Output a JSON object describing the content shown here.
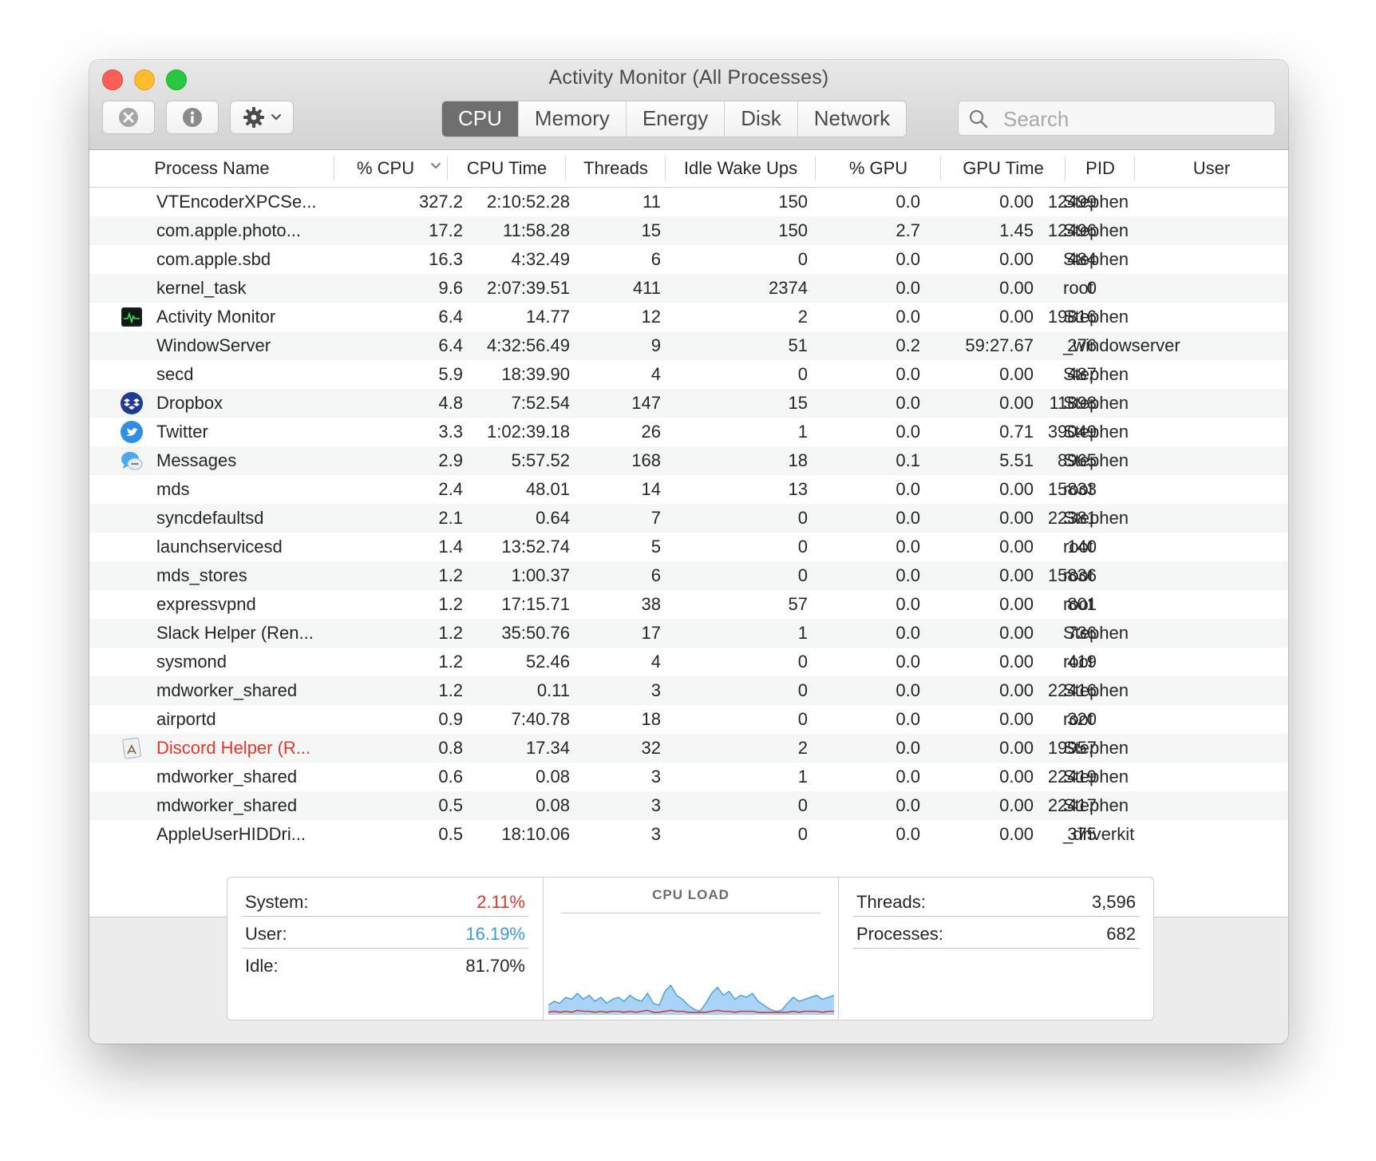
{
  "window": {
    "title": "Activity Monitor (All Processes)"
  },
  "toolbar": {
    "stop_icon": "xmark-circle-icon",
    "info_icon": "info-icon",
    "gear_icon": "gear-icon",
    "tabs": [
      {
        "label": "CPU",
        "active": true
      },
      {
        "label": "Memory",
        "active": false
      },
      {
        "label": "Energy",
        "active": false
      },
      {
        "label": "Disk",
        "active": false
      },
      {
        "label": "Network",
        "active": false
      }
    ],
    "search_placeholder": "Search"
  },
  "table": {
    "columns": [
      "Process Name",
      "% CPU",
      "CPU Time",
      "Threads",
      "Idle Wake Ups",
      "% GPU",
      "GPU Time",
      "PID",
      "User"
    ],
    "sort_column": "% CPU",
    "sort_direction": "descending",
    "rows": [
      {
        "icon": "",
        "name": "VTEncoderXPCSe...",
        "cpu": "327.2",
        "cpu_time": "2:10:52.28",
        "threads": "11",
        "idle": "150",
        "gpu": "0.0",
        "gpu_time": "0.00",
        "pid": "12499",
        "user": "Stephen"
      },
      {
        "icon": "",
        "name": "com.apple.photo...",
        "cpu": "17.2",
        "cpu_time": "11:58.28",
        "threads": "15",
        "idle": "150",
        "gpu": "2.7",
        "gpu_time": "1.45",
        "pid": "12496",
        "user": "Stephen"
      },
      {
        "icon": "",
        "name": "com.apple.sbd",
        "cpu": "16.3",
        "cpu_time": "4:32.49",
        "threads": "6",
        "idle": "0",
        "gpu": "0.0",
        "gpu_time": "0.00",
        "pid": "484",
        "user": "Stephen"
      },
      {
        "icon": "",
        "name": "kernel_task",
        "cpu": "9.6",
        "cpu_time": "2:07:39.51",
        "threads": "411",
        "idle": "2374",
        "gpu": "0.0",
        "gpu_time": "0.00",
        "pid": "0",
        "user": "root"
      },
      {
        "icon": "activity-monitor-icon",
        "name": "Activity Monitor",
        "cpu": "6.4",
        "cpu_time": "14.77",
        "threads": "12",
        "idle": "2",
        "gpu": "0.0",
        "gpu_time": "0.00",
        "pid": "19816",
        "user": "Stephen"
      },
      {
        "icon": "",
        "name": "WindowServer",
        "cpu": "6.4",
        "cpu_time": "4:32:56.49",
        "threads": "9",
        "idle": "51",
        "gpu": "0.2",
        "gpu_time": "59:27.67",
        "pid": "276",
        "user": "_windowserver"
      },
      {
        "icon": "",
        "name": "secd",
        "cpu": "5.9",
        "cpu_time": "18:39.90",
        "threads": "4",
        "idle": "0",
        "gpu": "0.0",
        "gpu_time": "0.00",
        "pid": "487",
        "user": "Stephen"
      },
      {
        "icon": "dropbox-icon",
        "name": "Dropbox",
        "cpu": "4.8",
        "cpu_time": "7:52.54",
        "threads": "147",
        "idle": "15",
        "gpu": "0.0",
        "gpu_time": "0.00",
        "pid": "11898",
        "user": "Stephen"
      },
      {
        "icon": "twitter-icon",
        "name": "Twitter",
        "cpu": "3.3",
        "cpu_time": "1:02:39.18",
        "threads": "26",
        "idle": "1",
        "gpu": "0.0",
        "gpu_time": "0.71",
        "pid": "39049",
        "user": "Stephen"
      },
      {
        "icon": "messages-icon",
        "name": "Messages",
        "cpu": "2.9",
        "cpu_time": "5:57.52",
        "threads": "168",
        "idle": "18",
        "gpu": "0.1",
        "gpu_time": "5.51",
        "pid": "8965",
        "user": "Stephen"
      },
      {
        "icon": "",
        "name": "mds",
        "cpu": "2.4",
        "cpu_time": "48.01",
        "threads": "14",
        "idle": "13",
        "gpu": "0.0",
        "gpu_time": "0.00",
        "pid": "15833",
        "user": "root"
      },
      {
        "icon": "",
        "name": "syncdefaultsd",
        "cpu": "2.1",
        "cpu_time": "0.64",
        "threads": "7",
        "idle": "0",
        "gpu": "0.0",
        "gpu_time": "0.00",
        "pid": "22381",
        "user": "Stephen"
      },
      {
        "icon": "",
        "name": "launchservicesd",
        "cpu": "1.4",
        "cpu_time": "13:52.74",
        "threads": "5",
        "idle": "0",
        "gpu": "0.0",
        "gpu_time": "0.00",
        "pid": "140",
        "user": "root"
      },
      {
        "icon": "",
        "name": "mds_stores",
        "cpu": "1.2",
        "cpu_time": "1:00.37",
        "threads": "6",
        "idle": "0",
        "gpu": "0.0",
        "gpu_time": "0.00",
        "pid": "15836",
        "user": "root"
      },
      {
        "icon": "",
        "name": "expressvpnd",
        "cpu": "1.2",
        "cpu_time": "17:15.71",
        "threads": "38",
        "idle": "57",
        "gpu": "0.0",
        "gpu_time": "0.00",
        "pid": "801",
        "user": "root"
      },
      {
        "icon": "",
        "name": "Slack Helper (Ren...",
        "cpu": "1.2",
        "cpu_time": "35:50.76",
        "threads": "17",
        "idle": "1",
        "gpu": "0.0",
        "gpu_time": "0.00",
        "pid": "736",
        "user": "Stephen"
      },
      {
        "icon": "",
        "name": "sysmond",
        "cpu": "1.2",
        "cpu_time": "52.46",
        "threads": "4",
        "idle": "0",
        "gpu": "0.0",
        "gpu_time": "0.00",
        "pid": "419",
        "user": "root"
      },
      {
        "icon": "",
        "name": "mdworker_shared",
        "cpu": "1.2",
        "cpu_time": "0.11",
        "threads": "3",
        "idle": "0",
        "gpu": "0.0",
        "gpu_time": "0.00",
        "pid": "22416",
        "user": "Stephen"
      },
      {
        "icon": "",
        "name": "airportd",
        "cpu": "0.9",
        "cpu_time": "7:40.78",
        "threads": "18",
        "idle": "0",
        "gpu": "0.0",
        "gpu_time": "0.00",
        "pid": "320",
        "user": "root"
      },
      {
        "icon": "generic-app-icon",
        "name": "Discord Helper (R...",
        "cpu": "0.8",
        "cpu_time": "17.34",
        "threads": "32",
        "idle": "2",
        "gpu": "0.0",
        "gpu_time": "0.00",
        "pid": "19957",
        "user": "Stephen",
        "not_responding": true
      },
      {
        "icon": "",
        "name": "mdworker_shared",
        "cpu": "0.6",
        "cpu_time": "0.08",
        "threads": "3",
        "idle": "1",
        "gpu": "0.0",
        "gpu_time": "0.00",
        "pid": "22419",
        "user": "Stephen"
      },
      {
        "icon": "",
        "name": "mdworker_shared",
        "cpu": "0.5",
        "cpu_time": "0.08",
        "threads": "3",
        "idle": "0",
        "gpu": "0.0",
        "gpu_time": "0.00",
        "pid": "22417",
        "user": "Stephen"
      },
      {
        "icon": "",
        "name": "AppleUserHIDDri...",
        "cpu": "0.5",
        "cpu_time": "18:10.06",
        "threads": "3",
        "idle": "0",
        "gpu": "0.0",
        "gpu_time": "0.00",
        "pid": "375",
        "user": "_driverkit"
      }
    ]
  },
  "summary": {
    "system_label": "System:",
    "system_value": "2.11%",
    "user_label": "User:",
    "user_value": "16.19%",
    "idle_label": "Idle:",
    "idle_value": "81.70%",
    "cpu_load_title": "CPU LOAD",
    "threads_label": "Threads:",
    "threads_value": "3,596",
    "processes_label": "Processes:",
    "processes_value": "682",
    "colors": {
      "system": "#e0362b",
      "user": "#3a9ae0"
    },
    "cpu_load_user": [
      8,
      12,
      10,
      16,
      14,
      20,
      14,
      18,
      12,
      16,
      10,
      14,
      16,
      12,
      18,
      14,
      12,
      20,
      10,
      8,
      22,
      28,
      18,
      14,
      8,
      4,
      2,
      10,
      20,
      26,
      18,
      22,
      14,
      18,
      16,
      20,
      12,
      8,
      4,
      2,
      3,
      10,
      16,
      12,
      14,
      16,
      18,
      14,
      16,
      18
    ],
    "cpu_load_system": [
      1,
      2,
      1,
      2,
      1,
      3,
      2,
      2,
      1,
      2,
      1,
      2,
      2,
      1,
      2,
      1,
      2,
      3,
      1,
      1,
      2,
      3,
      2,
      2,
      1,
      1,
      1,
      1,
      2,
      3,
      2,
      2,
      1,
      2,
      2,
      2,
      1,
      1,
      1,
      1,
      1,
      1,
      2,
      1,
      2,
      2,
      2,
      1,
      2,
      2
    ]
  }
}
